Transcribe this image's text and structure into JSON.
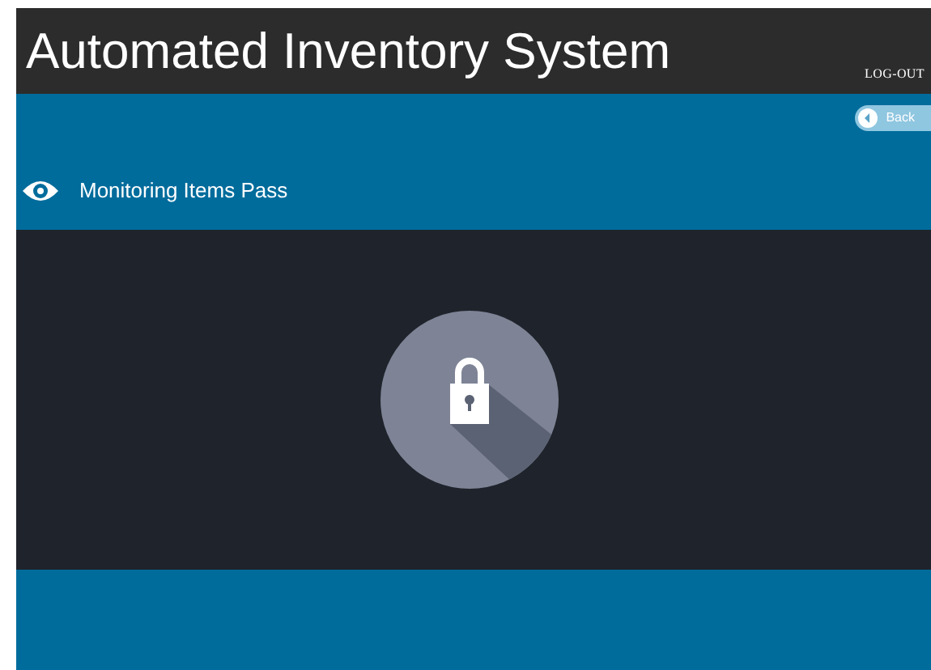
{
  "header": {
    "title": "Automated Inventory System",
    "logout": "LOG-OUT"
  },
  "toolbar": {
    "back": "Back",
    "section_title": "Monitoring Items Pass"
  }
}
